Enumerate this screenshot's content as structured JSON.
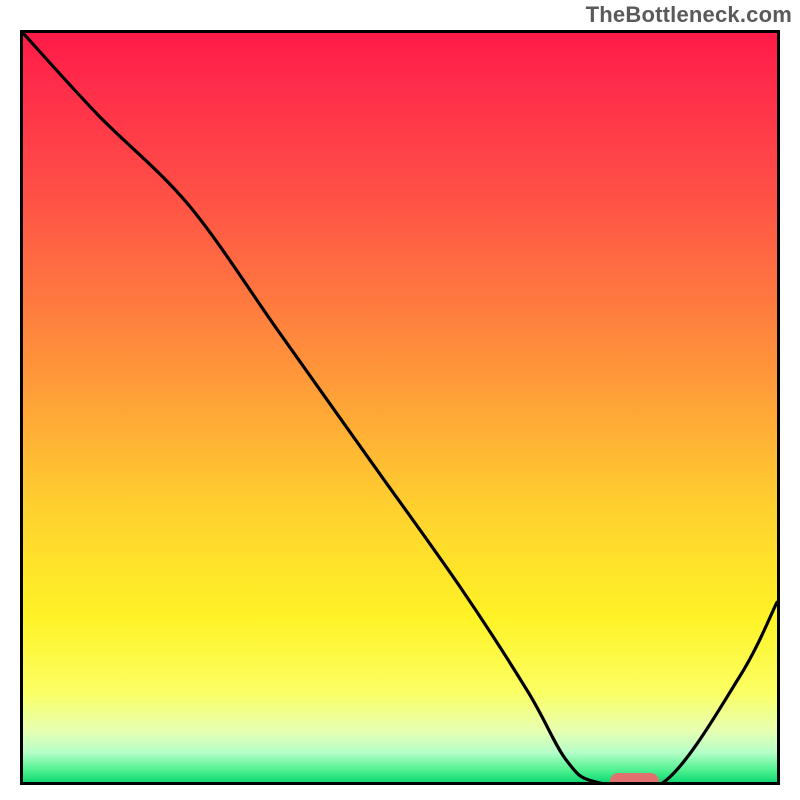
{
  "watermark": "TheBottleneck.com",
  "chart_data": {
    "type": "line",
    "title": "",
    "xlabel": "",
    "ylabel": "",
    "xlim": [
      0,
      100
    ],
    "ylim": [
      0,
      100
    ],
    "grid": false,
    "series": [
      {
        "name": "curve",
        "x": [
          0,
          10,
          22,
          34,
          46,
          58,
          67,
          72,
          76,
          85,
          95,
          100
        ],
        "y": [
          100,
          89,
          77,
          60,
          43,
          26,
          12,
          3,
          0,
          0,
          14,
          24
        ]
      }
    ],
    "annotations": [
      {
        "name": "optimum-marker",
        "x": 80.5,
        "y": 0,
        "width_pct": 6.5,
        "height_pct": 2.2
      }
    ],
    "background_gradient": {
      "top": "#ff1a48",
      "mid": "#ffd22e",
      "bottom": "#10d873"
    }
  }
}
